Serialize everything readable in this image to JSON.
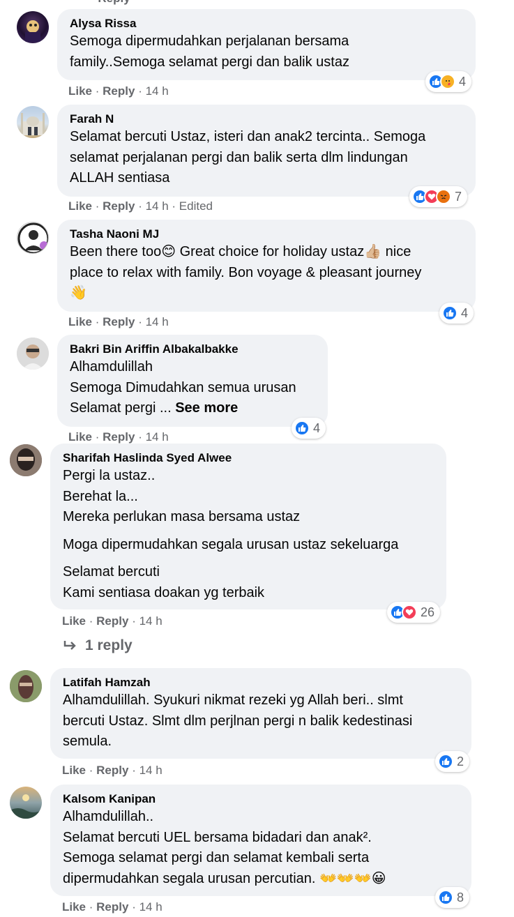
{
  "top_fragment": "· Reply",
  "comments": [
    {
      "author": "Alysa Rissa",
      "lines": [
        "Semoga dipermudahkan perjalanan bersama",
        "family..Semoga selamat pergi dan balik ustaz"
      ],
      "reaction_count": "4",
      "like": "Like",
      "reply": "Reply",
      "time": "· 14 h"
    },
    {
      "author": "Farah N",
      "lines": [
        "Selamat bercuti Ustaz, isteri dan anak2 tercinta.. Semoga",
        "selamat perjalanan pergi dan balik serta dlm lindungan",
        "ALLAH sentiasa"
      ],
      "reaction_count": "7",
      "like": "Like",
      "reply": "Reply",
      "time": "· 14 h",
      "edited": "· Edited"
    },
    {
      "author": "Tasha Naoni MJ",
      "lines": [
        "Been there too😊 Great choice for holiday ustaz👍🏼 nice",
        "place to relax with family. Bon voyage & pleasant journey",
        "👋"
      ],
      "reaction_count": "4",
      "like": "Like",
      "reply": "Reply",
      "time": "· 14 h"
    },
    {
      "author": "Bakri Bin Ariffin Albakalbakke",
      "lines": [
        "Alhamdulillah",
        "Semoga Dimudahkan semua urusan",
        "Selamat pergi ... "
      ],
      "see_more": "See more",
      "reaction_count": "4",
      "like": "Like",
      "reply": "Reply",
      "time": "· 14 h"
    },
    {
      "author": "Sharifah Haslinda Syed Alwee",
      "lines": [
        "Pergi la ustaz..",
        "Berehat la...",
        "Mereka perlukan masa bersama ustaz",
        "Moga dipermudahkan segala urusan ustaz sekeluarga",
        "Selamat bercuti",
        "Kami sentiasa doakan yg terbaik"
      ],
      "reaction_count": "26",
      "like": "Like",
      "reply": "Reply",
      "time": "· 14 h",
      "replies": "1 reply"
    },
    {
      "author": "Latifah Hamzah",
      "lines": [
        "Alhamdulillah. Syukuri nikmat rezeki yg Allah beri.. slmt",
        "bercuti Ustaz. Slmt dlm perjlnan pergi n balik kedestinasi",
        "semula."
      ],
      "reaction_count": "2",
      "like": "Like",
      "reply": "Reply",
      "time": "· 14 h"
    },
    {
      "author": "Kalsom Kanipan",
      "lines": [
        "Alhamdulillah..",
        "Selamat bercuti UEL bersama bidadari dan anak².",
        "Semoga selamat pergi dan selamat kembali serta",
        "dipermudahkan segala urusan percutian. 👐👐👐😀"
      ],
      "reaction_count": "8",
      "like": "Like",
      "reply": "Reply",
      "time": "· 14 h"
    }
  ],
  "colors": {
    "bubble": "#f0f2f5",
    "meta": "#65676b",
    "like_blue": "#1877f2",
    "love_red": "#f33e58"
  }
}
